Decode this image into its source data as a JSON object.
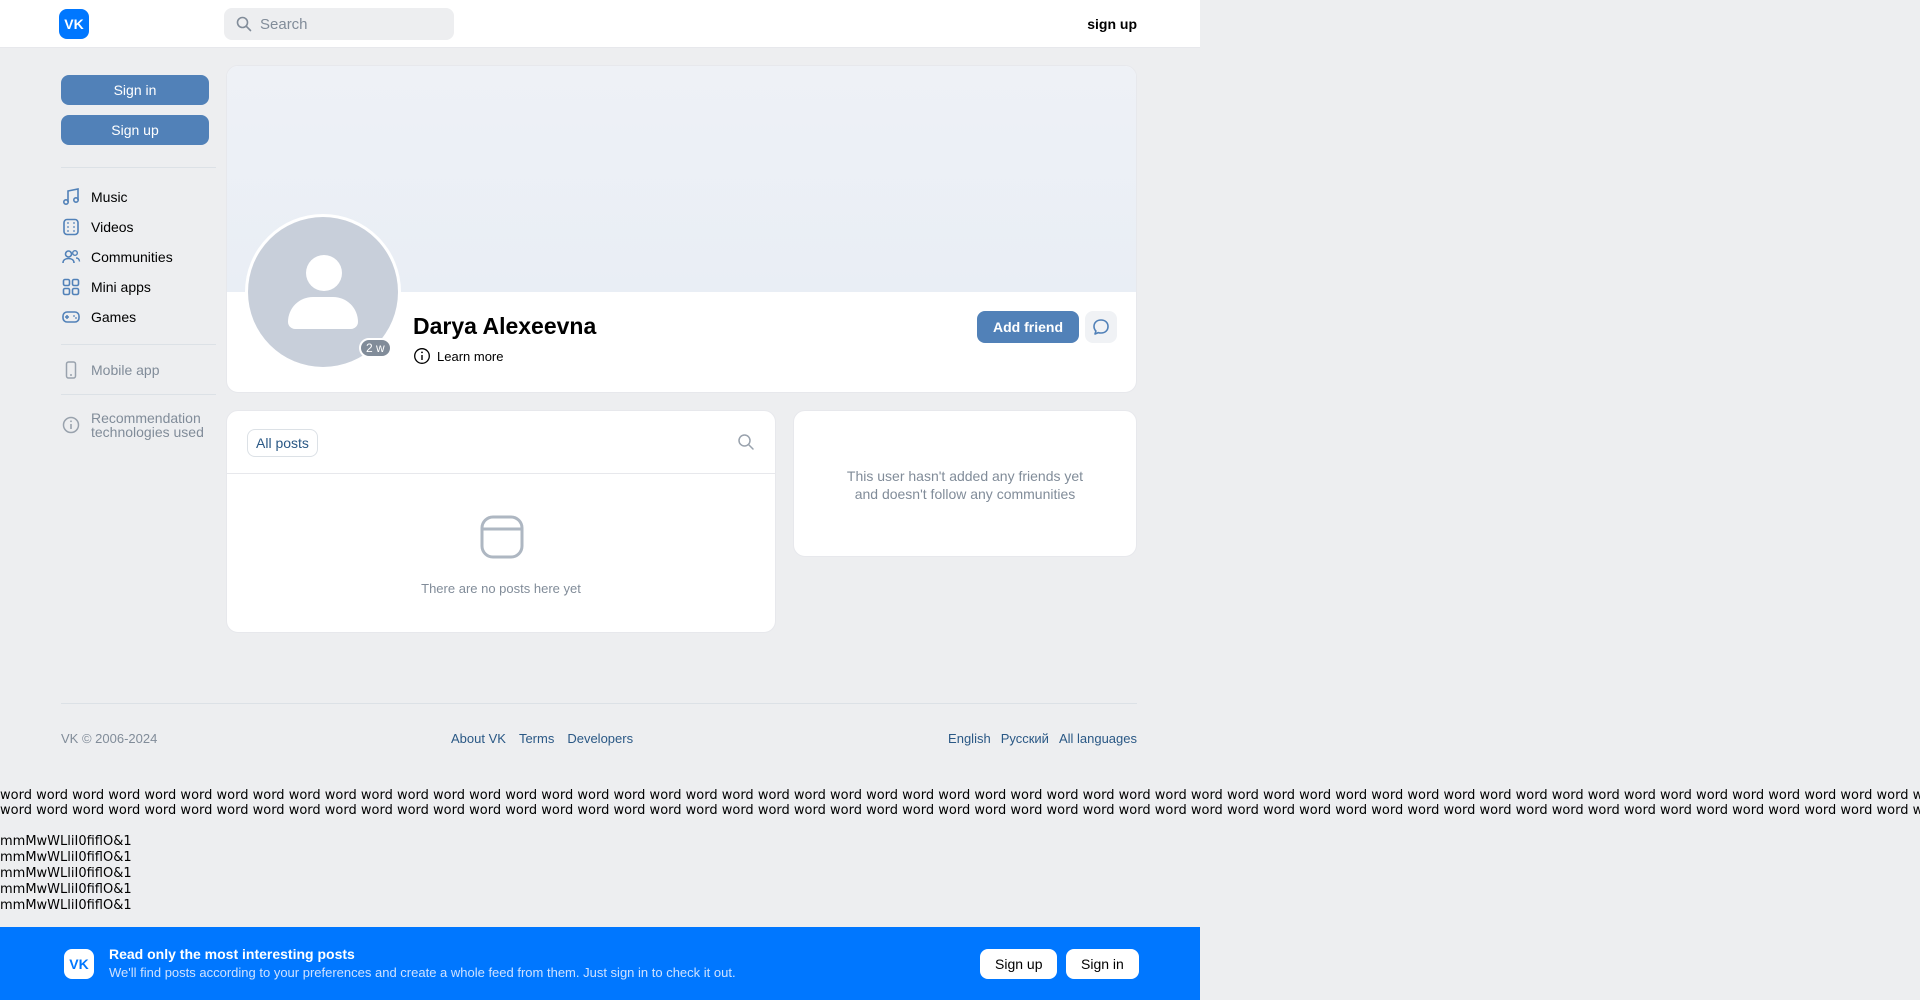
{
  "header": {
    "logo": "VK",
    "search_placeholder": "Search",
    "signup_label": "sign up"
  },
  "sidebar": {
    "sign_in": "Sign in",
    "sign_up": "Sign up",
    "items": [
      {
        "label": "Music",
        "icon": "music-icon"
      },
      {
        "label": "Videos",
        "icon": "video-icon"
      },
      {
        "label": "Communities",
        "icon": "communities-icon"
      },
      {
        "label": "Mini apps",
        "icon": "mini-apps-icon"
      },
      {
        "label": "Games",
        "icon": "gamepad-icon"
      }
    ],
    "mobile_app": "Mobile app",
    "recommendation_line1": "Recommendation",
    "recommendation_line2": "technologies used"
  },
  "profile": {
    "name": "Darya Alexeevna",
    "last_seen": "2 w",
    "learn_more": "Learn more",
    "add_friend": "Add friend"
  },
  "posts": {
    "tab_all": "All posts",
    "empty": "There are no posts here yet"
  },
  "friends": {
    "empty_line1": "This user hasn't added any friends yet",
    "empty_line2": "and doesn't follow any communities"
  },
  "footer": {
    "copyright": "VK © 2006-2024",
    "links": [
      "About VK",
      "Terms",
      "Developers"
    ],
    "languages": [
      "English",
      "Русский",
      "All languages"
    ]
  },
  "filler": {
    "word": "word",
    "glyphs": "mmMwWLliI0fiflO&1"
  },
  "banner": {
    "title": "Read only the most interesting posts",
    "subtitle": "We'll find posts according to your preferences and create a whole feed from them. Just sign in to check it out.",
    "sign_up": "Sign up",
    "sign_in": "Sign in"
  },
  "colors": {
    "accent": "#5181b8",
    "brand": "#0077ff",
    "background": "#edeef0"
  }
}
